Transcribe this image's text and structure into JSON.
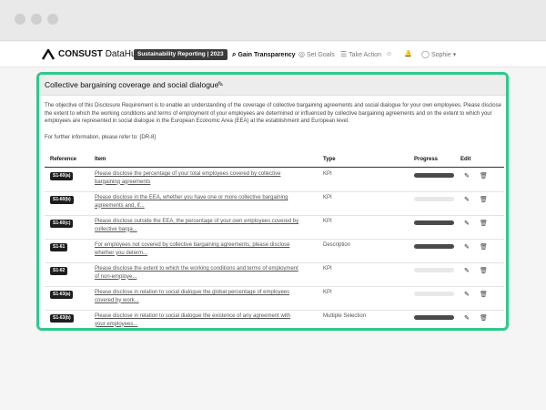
{
  "colors": {
    "accent": "#2fc98b",
    "dark": "#3c3c3c"
  },
  "nav": {
    "brand_bold": "CONSUST",
    "brand_light": "DataHub",
    "reporting_badge": "Sustainability Reporting | 2023",
    "items": [
      {
        "icon": "search-icon",
        "label": "Gain Transparency",
        "active": true
      },
      {
        "icon": "target-icon",
        "label": "Set Goals",
        "active": false
      },
      {
        "icon": "list-icon",
        "label": "Take Action",
        "active": false
      }
    ],
    "user": "Sophie"
  },
  "panel": {
    "title": "Collective bargaining coverage and social dialogue",
    "description": "The objective of this Disclosure Requirement is to enable an understanding of the coverage of collective bargaining agreements and social dialogue for your own employees. Please disclose the extent to which the working conditions and terms of employment of your employees are determined or influenced by collective bargaining agreements and on the extent to which your employees are represented in social dialogue in the European Economic Area (EEA) at the establishment and European level.",
    "further_info": "For further information, please refer to: {DR-8}"
  },
  "table": {
    "headers": {
      "reference": "Reference",
      "item": "Item",
      "type": "Type",
      "progress": "Progress",
      "edit": "Edit"
    },
    "rows": [
      {
        "ref": "S1-60(a)",
        "item": "Please disclose the percentage of your total employees covered by collective bargaining agreements",
        "type": "KPI",
        "progress": 1.0
      },
      {
        "ref": "S1-60(b)",
        "item": "Please disclose in the EEA, whether you have one or more collective bargaining agreements and, if...",
        "type": "KPI",
        "progress": 0.0
      },
      {
        "ref": "S1-60(c)",
        "item": "Please disclose outside the EEA, the percentage of your own employees covered by collective barga...",
        "type": "KPI",
        "progress": 1.0
      },
      {
        "ref": "S1-61",
        "item": "For employees not covered by collective bargaining agreements, please disclose whether you determ...",
        "type": "Description",
        "progress": 1.0
      },
      {
        "ref": "S1-62",
        "item": "Please disclose the extent to which the working conditions and terms of employment of non-employe...",
        "type": "KPI",
        "progress": 0.0
      },
      {
        "ref": "S1-63(a)",
        "item": "Please disclose in relation to social dialogue the global percentage of employees covered by work...",
        "type": "KPI",
        "progress": 0.0
      },
      {
        "ref": "S1-63(b)",
        "item": "Please disclose in relation to social dialogue the existence of any agreement with your employees...",
        "type": "Multiple Selection",
        "progress": 1.0
      }
    ]
  }
}
